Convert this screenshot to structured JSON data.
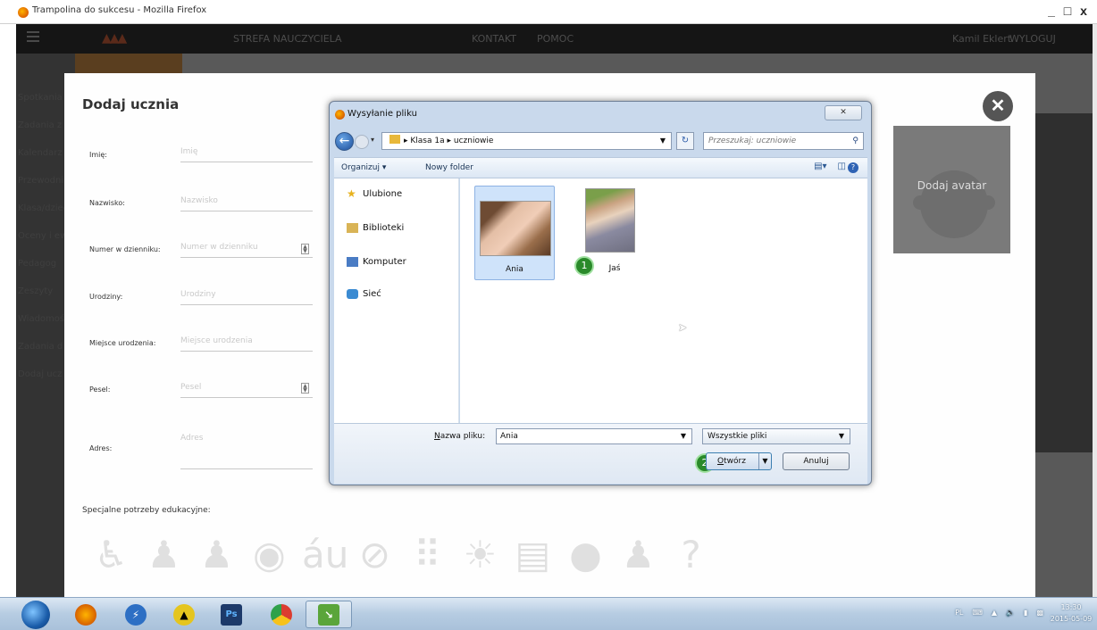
{
  "window": {
    "title": "Trampolina do sukcesu - Mozilla Firefox",
    "controls": [
      "_",
      "□",
      "x"
    ]
  },
  "topnav": {
    "items": [
      "STREFA NAUCZYCIELA",
      "KONTAKT",
      "POMOC"
    ],
    "user": "Kamil Eklert",
    "logout": "WYLOGUJ"
  },
  "sidebar": {
    "items": [
      "Spotkania",
      "Zadania z",
      "Kalendarz",
      "Przewodnik",
      "Klasa/dzieci",
      "Oceny i ew",
      "Pedagog",
      "Zeszyty",
      "Wiadomości",
      "Zadania d",
      "Dodaj ucz"
    ]
  },
  "form": {
    "title": "Dodaj ucznia",
    "fields": [
      {
        "label": "Imię:",
        "placeholder": "Imię"
      },
      {
        "label": "Nazwisko:",
        "placeholder": "Nazwisko"
      },
      {
        "label": "Numer w dzienniku:",
        "placeholder": "Numer w dzienniku"
      },
      {
        "label": "Urodziny:",
        "placeholder": "Urodziny"
      },
      {
        "label": "Miejsce urodzenia:",
        "placeholder": "Miejsce urodzenia"
      },
      {
        "label": "Pesel:",
        "placeholder": "Pesel"
      },
      {
        "label": "Adres:",
        "placeholder": "Adres"
      }
    ],
    "special_needs_label": "Specjalne potrzeby edukacyjne:",
    "special_icons": [
      "wheelchair-icon",
      "person-icon",
      "person-with-cane-icon",
      "palette-icon",
      "dyslexia-icon",
      "no-speech-icon",
      "braille-icon",
      "adhd-icon",
      "document-icon",
      "coins-icon",
      "parent-child-icon",
      "question-icon"
    ],
    "avatar_label": "Dodaj avatar"
  },
  "dialog": {
    "title": "Wysyłanie pliku",
    "close_glyph": "✕",
    "path": [
      "Klasa 1a",
      "uczniowie"
    ],
    "search_placeholder": "Przeszukaj: uczniowie",
    "toolbar": {
      "organize": "Organizuj ▾",
      "new_folder": "Nowy folder"
    },
    "nav": [
      "Ulubione",
      "Biblioteki",
      "Komputer",
      "Sieć"
    ],
    "files": [
      {
        "name": "Ania",
        "selected": true
      },
      {
        "name": "Jaś",
        "selected": false
      }
    ],
    "badge1": "1",
    "badge2": "2",
    "filename_label_prefix": "N",
    "filename_label_rest": "azwa pliku:",
    "filename_value": "Ania",
    "filetype_value": "Wszystkie pliki",
    "open_label_prefix": "O",
    "open_label_rest": "twórz",
    "cancel_label": "Anuluj"
  },
  "taskbar": {
    "tray_lang": "PL",
    "time": "13:30",
    "date": "2015-05-09"
  },
  "colors": {
    "accent": "#2a8a2a",
    "selection": "#cfe3fa",
    "overlay": "#595959"
  }
}
